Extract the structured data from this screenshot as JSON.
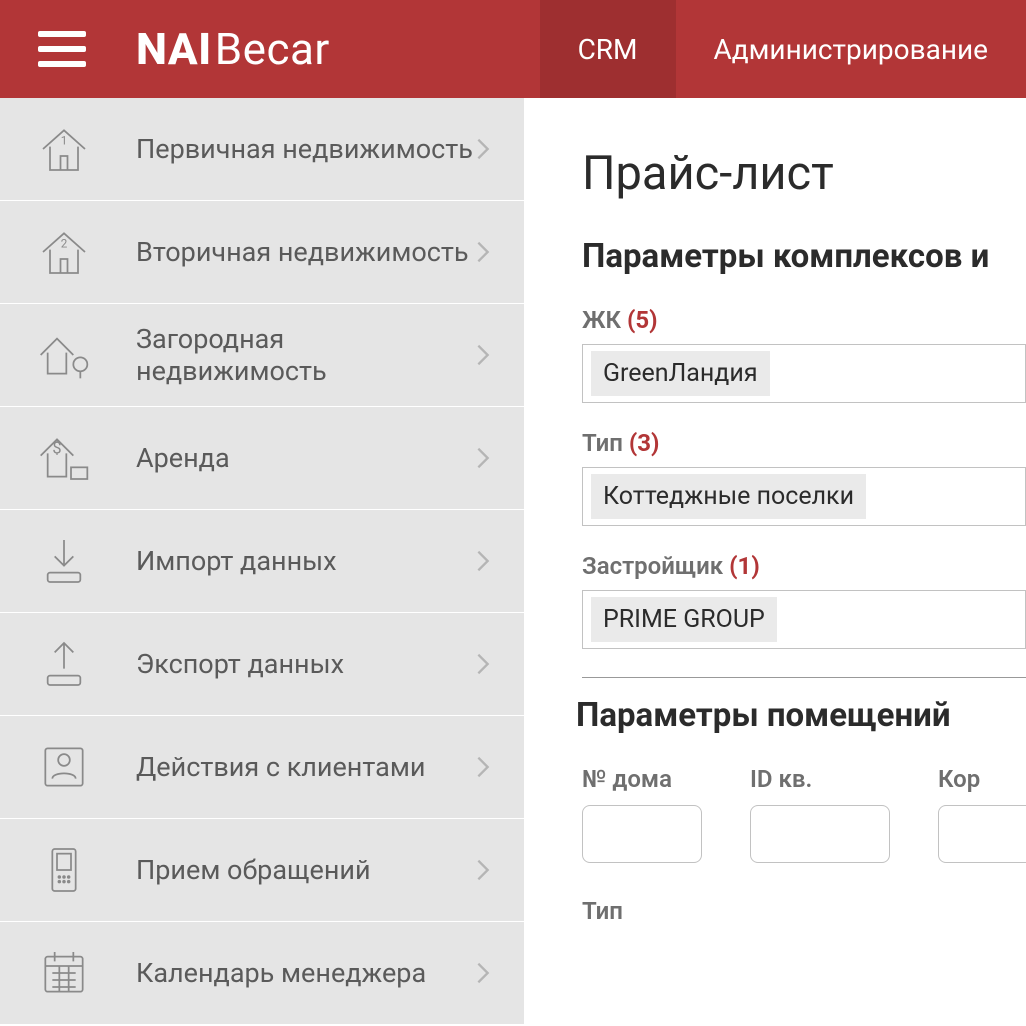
{
  "header": {
    "logo_bold": "NAI",
    "logo_thin": "Becar",
    "nav": {
      "crm": "CRM",
      "admin": "Администрирование"
    }
  },
  "sidebar": {
    "items": [
      {
        "label": "Первичная недвижимость"
      },
      {
        "label": "Вторичная недвижимость"
      },
      {
        "label": "Загородная недвижимость"
      },
      {
        "label": "Аренда"
      },
      {
        "label": "Импорт данных"
      },
      {
        "label": "Экспорт данных"
      },
      {
        "label": "Действия с клиентами"
      },
      {
        "label": "Прием обращений"
      },
      {
        "label": "Календарь менеджера"
      }
    ]
  },
  "main": {
    "title": "Прайс-лист",
    "section1_title": "Параметры комплексов и",
    "filters": {
      "zk": {
        "label": "ЖК",
        "count": "(5)",
        "value": "GreenЛандия"
      },
      "type": {
        "label": "Тип",
        "count": "(3)",
        "value": "Коттеджные поселки"
      },
      "dev": {
        "label": "Застройщик",
        "count": "(1)",
        "value": "PRIME GROUP"
      }
    },
    "section2_title": "Параметры помещений",
    "params": {
      "house_no": "№ дома",
      "apt_id": "ID кв.",
      "korp": "Кор",
      "type": "Тип"
    }
  }
}
